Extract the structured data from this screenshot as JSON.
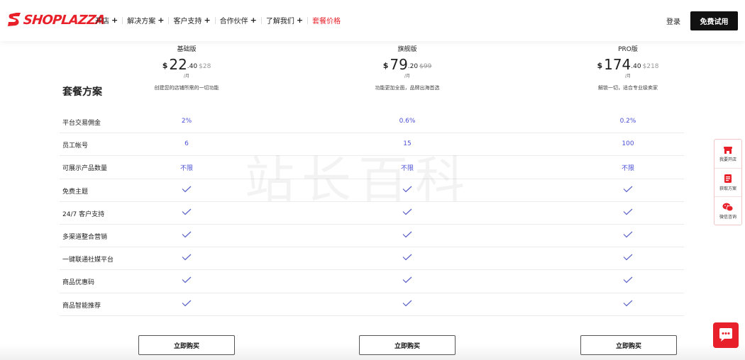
{
  "header": {
    "logo_text": "SHOPLAZZA",
    "nav": [
      {
        "label": "开店",
        "has_plus": true
      },
      {
        "label": "解决方案",
        "has_plus": true
      },
      {
        "label": "客户支持",
        "has_plus": true
      },
      {
        "label": "合作伙伴",
        "has_plus": true
      },
      {
        "label": "了解我们",
        "has_plus": true
      },
      {
        "label": "套餐价格",
        "has_plus": false,
        "active": true
      }
    ],
    "plus_symbol": "+",
    "login_label": "登录",
    "trial_label": "免费试用"
  },
  "section_title": "套餐方案",
  "plans": [
    {
      "name": "基础版",
      "currency": "$",
      "price_int": "22",
      "price_dec": ".40",
      "old_price": "$28",
      "old_strike": false,
      "per": "/月",
      "desc": "创建您的店铺所需的一切功能"
    },
    {
      "name": "旗舰版",
      "currency": "$",
      "price_int": "79",
      "price_dec": ".20",
      "old_price": "$99",
      "old_strike": true,
      "per": "/月",
      "desc": "功能更加全面，品牌出海首选"
    },
    {
      "name": "PRO版",
      "currency": "$",
      "price_int": "174",
      "price_dec": ".40",
      "old_price": "$218",
      "old_strike": false,
      "per": "/月",
      "desc": "解锁一切，适合专业级卖家"
    }
  ],
  "features": [
    {
      "label": "平台交易佣金",
      "values": [
        "2%",
        "0.6%",
        "0.2%"
      ]
    },
    {
      "label": "员工帐号",
      "values": [
        "6",
        "15",
        "100"
      ]
    },
    {
      "label": "可展示产品数量",
      "values": [
        "不限",
        "不限",
        "不限"
      ]
    },
    {
      "label": "免费主题",
      "values": [
        "check",
        "check",
        "check"
      ]
    },
    {
      "label": "24/7 客户支持",
      "values": [
        "check",
        "check",
        "check"
      ]
    },
    {
      "label": "多渠道整合营销",
      "values": [
        "check",
        "check",
        "check"
      ]
    },
    {
      "label": "一键联通社媒平台",
      "values": [
        "check",
        "check",
        "check"
      ]
    },
    {
      "label": "商品优惠码",
      "values": [
        "check",
        "check",
        "check"
      ]
    },
    {
      "label": "商品智能推荐",
      "values": [
        "check",
        "check",
        "check"
      ]
    }
  ],
  "buy_label": "立即购买",
  "side_panel": [
    {
      "label": "我要开店",
      "icon": "store-icon"
    },
    {
      "label": "获取方案",
      "icon": "document-icon"
    },
    {
      "label": "微信咨询",
      "icon": "wechat-icon"
    }
  ],
  "watermark": "站长百科",
  "colors": {
    "brand": "#e8202a",
    "value_text": "#4a4fd6",
    "check": "#5a62c8",
    "trial_button": "#111111"
  }
}
